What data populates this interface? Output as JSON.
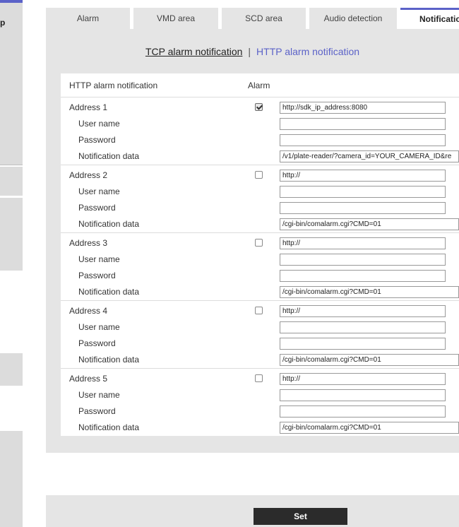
{
  "sidebar": {
    "label": "p"
  },
  "tabs": [
    {
      "label": "Alarm",
      "active": false
    },
    {
      "label": "VMD area",
      "active": false
    },
    {
      "label": "SCD area",
      "active": false
    },
    {
      "label": "Audio detection",
      "active": false
    },
    {
      "label": "Notification",
      "active": true
    }
  ],
  "sub_links": {
    "tcp": "TCP alarm notification",
    "separator": "|",
    "http": "HTTP alarm notification"
  },
  "table": {
    "header_main": "HTTP alarm notification",
    "header_alarm": "Alarm",
    "field_labels": {
      "user_name": "User name",
      "password": "Password",
      "notification_data": "Notification data"
    },
    "addresses": [
      {
        "label": "Address 1",
        "checked": true,
        "url": "http://sdk_ip_address:8080",
        "user": "",
        "password": "",
        "data": "/v1/plate-reader/?camera_id=YOUR_CAMERA_ID&re"
      },
      {
        "label": "Address 2",
        "checked": false,
        "url": "http://",
        "user": "",
        "password": "",
        "data": "/cgi-bin/comalarm.cgi?CMD=01"
      },
      {
        "label": "Address 3",
        "checked": false,
        "url": "http://",
        "user": "",
        "password": "",
        "data": "/cgi-bin/comalarm.cgi?CMD=01"
      },
      {
        "label": "Address 4",
        "checked": false,
        "url": "http://",
        "user": "",
        "password": "",
        "data": "/cgi-bin/comalarm.cgi?CMD=01"
      },
      {
        "label": "Address 5",
        "checked": false,
        "url": "http://",
        "user": "",
        "password": "",
        "data": "/cgi-bin/comalarm.cgi?CMD=01"
      }
    ]
  },
  "footer": {
    "set_label": "Set"
  },
  "colors": {
    "accent": "#5b62c8",
    "panel": "#e5e5e5",
    "button": "#2b2b2b"
  }
}
